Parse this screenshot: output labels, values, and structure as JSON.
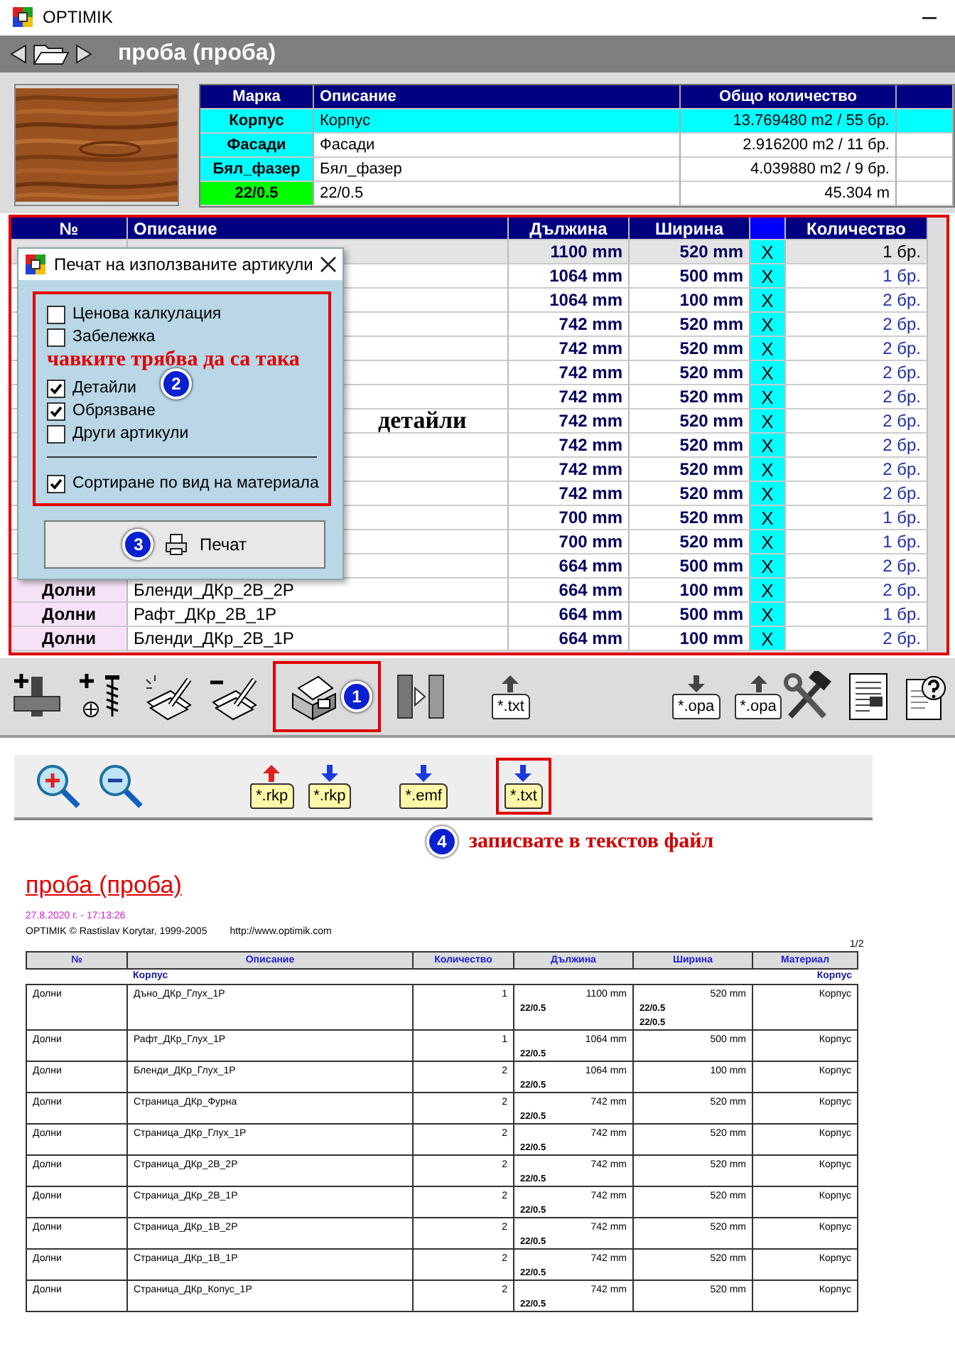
{
  "window": {
    "title": "OPTIMIK"
  },
  "header": {
    "title": "проба  (проба)"
  },
  "materials": {
    "columns": [
      "Марка",
      "Описание",
      "Общо количество"
    ],
    "rows": [
      {
        "mark": "Корпус",
        "description": "Корпус",
        "total": "13.769480 m2 / 55 бр.",
        "color": "#00ffff",
        "selected": true
      },
      {
        "mark": "Фасади",
        "description": "Фасади",
        "total": "2.916200 m2 / 11 бр.",
        "color": "#00ffff",
        "selected": false
      },
      {
        "mark": "Бял_фазер",
        "description": "Бял_фазер",
        "total": "4.039880 m2 / 9 бр.",
        "color": "#00ffff",
        "selected": false
      },
      {
        "mark": "22/0.5",
        "description": "22/0.5",
        "total": "45.304 m",
        "color": "#00ff00",
        "selected": false
      }
    ]
  },
  "parts": {
    "columns": [
      "№",
      "Описание",
      "Дължина",
      "Ширина",
      "Количество"
    ],
    "rows": [
      {
        "length": "1100 mm",
        "width": "520 mm",
        "flag": "X",
        "quantity": "1 бр.",
        "selected": true
      },
      {
        "length": "1064 mm",
        "width": "500 mm",
        "flag": "X",
        "quantity": "1 бр.",
        "selected": false
      },
      {
        "length": "1064 mm",
        "width": "100 mm",
        "flag": "X",
        "quantity": "2 бр.",
        "selected": false
      },
      {
        "length": "742 mm",
        "width": "520 mm",
        "flag": "X",
        "quantity": "2 бр.",
        "selected": false
      },
      {
        "length": "742 mm",
        "width": "520 mm",
        "flag": "X",
        "quantity": "2 бр.",
        "selected": false
      },
      {
        "length": "742 mm",
        "width": "520 mm",
        "flag": "X",
        "quantity": "2 бр.",
        "selected": false
      },
      {
        "length": "742 mm",
        "width": "520 mm",
        "flag": "X",
        "quantity": "2 бр.",
        "selected": false
      },
      {
        "annotation": "детайли",
        "length": "742 mm",
        "width": "520 mm",
        "flag": "X",
        "quantity": "2 бр.",
        "selected": false
      },
      {
        "length": "742 mm",
        "width": "520 mm",
        "flag": "X",
        "quantity": "2 бр.",
        "selected": false
      },
      {
        "length": "742 mm",
        "width": "520 mm",
        "flag": "X",
        "quantity": "2 бр.",
        "selected": false
      },
      {
        "length": "742 mm",
        "width": "520 mm",
        "flag": "X",
        "quantity": "2 бр.",
        "selected": false
      },
      {
        "length": "700 mm",
        "width": "520 mm",
        "flag": "X",
        "quantity": "1 бр.",
        "selected": false
      },
      {
        "length": "700 mm",
        "width": "520 mm",
        "flag": "X",
        "quantity": "1 бр.",
        "selected": false
      },
      {
        "length": "664 mm",
        "width": "500 mm",
        "flag": "X",
        "quantity": "2 бр.",
        "selected": false
      },
      {
        "no": "Долни",
        "description": "Бленди_ДКр_2В_2Р",
        "length": "664 mm",
        "width": "100 mm",
        "flag": "X",
        "quantity": "2 бр.",
        "selected": false
      },
      {
        "no": "Долни",
        "description": "Рафт_ДКр_2В_1Р",
        "length": "664 mm",
        "width": "500 mm",
        "flag": "X",
        "quantity": "1 бр.",
        "selected": false
      },
      {
        "no": "Долни",
        "description": "Бленди_ДКр_2В_1Р",
        "length": "664 mm",
        "width": "100 mm",
        "flag": "X",
        "quantity": "2 бр.",
        "selected": false
      }
    ]
  },
  "dialog": {
    "title": "Печат на използваните артикули",
    "badge": "2",
    "note": "чавките трябва да са така",
    "options": [
      {
        "label": "Ценова калкулация",
        "checked": false
      },
      {
        "label": "Забележка",
        "checked": false
      },
      {
        "label": "Детайли",
        "checked": true
      },
      {
        "label": "Обрязване",
        "checked": true
      },
      {
        "label": "Други артикули",
        "checked": false
      }
    ],
    "sort_option": {
      "label": "Сортиране по вид на материала",
      "checked": true
    },
    "button": {
      "label": "Печат",
      "badge": "3"
    }
  },
  "toolbar": {
    "groups": [
      [
        {
          "kind": "plus-panel"
        },
        {
          "kind": "plus-screw"
        },
        {
          "kind": "pencil-paper"
        },
        {
          "kind": "minus-pencil"
        },
        {
          "kind": "printer",
          "highlighted": true,
          "badge": "1"
        },
        {
          "kind": "split"
        },
        {
          "kind": "file",
          "label": "*.txt",
          "arrow_up": true
        }
      ],
      [
        {
          "kind": "file",
          "label": "*.opa",
          "arrow_up": false
        },
        {
          "kind": "file",
          "label": "*.opa",
          "arrow_up": true
        }
      ],
      [
        {
          "kind": "tools"
        },
        {
          "kind": "document"
        },
        {
          "kind": "help"
        }
      ]
    ]
  },
  "preview": {
    "toolbar": {
      "groups": [
        [
          {
            "kind": "zoom-in"
          },
          {
            "kind": "zoom-out"
          }
        ],
        [
          {
            "kind": "file",
            "label": "*.rkp",
            "arrow_up": true
          },
          {
            "kind": "file",
            "label": "*.rkp",
            "arrow_up": false
          }
        ],
        [
          {
            "kind": "file",
            "label": "*.emf",
            "arrow_up": false
          }
        ],
        [
          {
            "kind": "file",
            "label": "*.txt",
            "arrow_up": false,
            "highlighted": true
          }
        ]
      ]
    },
    "note": {
      "badge": "4",
      "text": "записвате в текстов файл"
    },
    "report": {
      "title": "проба  (проба)",
      "date": "27.8.2020 г.  -  17:13:26",
      "credits": "OPTIMIK  © Rastislav Korytar, 1999-2005",
      "url": "http://www.optimik.com",
      "page": "1/2",
      "columns": [
        "№",
        "Описание",
        "Количество",
        "Дължина",
        "Ширина",
        "Материал"
      ],
      "group": {
        "description": "Корпус",
        "material": "Корпус"
      },
      "rows": [
        {
          "no": "Долни",
          "description": "Дъно_ДКр_Глух_1Р",
          "quantity": "1",
          "length": "1100 mm",
          "length_edges": [
            "22/0.5"
          ],
          "width": "520 mm",
          "width_edges": [
            "22/0.5",
            "22/0.5"
          ],
          "material": "Корпус"
        },
        {
          "no": "Долни",
          "description": "Рафт_ДКр_Глух_1Р",
          "quantity": "1",
          "length": "1064 mm",
          "length_edges": [
            "22/0.5"
          ],
          "width": "500 mm",
          "material": "Корпус"
        },
        {
          "no": "Долни",
          "description": "Бленди_ДКр_Глух_1Р",
          "quantity": "2",
          "length": "1064 mm",
          "length_edges": [
            "22/0.5"
          ],
          "width": "100 mm",
          "material": "Корпус"
        },
        {
          "no": "Долни",
          "description": "Страница_ДКр_Фурна",
          "quantity": "2",
          "length": "742 mm",
          "length_edges": [
            "22/0.5"
          ],
          "width": "520 mm",
          "material": "Корпус"
        },
        {
          "no": "Долни",
          "description": "Страница_ДКр_Глух_1Р",
          "quantity": "2",
          "length": "742 mm",
          "length_edges": [
            "22/0.5"
          ],
          "width": "520 mm",
          "material": "Корпус"
        },
        {
          "no": "Долни",
          "description": "Страница_ДКр_2В_2Р",
          "quantity": "2",
          "length": "742 mm",
          "length_edges": [
            "22/0.5"
          ],
          "width": "520 mm",
          "material": "Корпус"
        },
        {
          "no": "Долни",
          "description": "Страница_ДКр_2В_1Р",
          "quantity": "2",
          "length": "742 mm",
          "length_edges": [
            "22/0.5"
          ],
          "width": "520 mm",
          "material": "Корпус"
        },
        {
          "no": "Долни",
          "description": "Страница_ДКр_1В_2Р",
          "quantity": "2",
          "length": "742 mm",
          "length_edges": [
            "22/0.5"
          ],
          "width": "520 mm",
          "material": "Корпус"
        },
        {
          "no": "Долни",
          "description": "Страница_ДКр_1В_1Р",
          "quantity": "2",
          "length": "742 mm",
          "length_edges": [
            "22/0.5"
          ],
          "width": "520 mm",
          "material": "Корпус"
        },
        {
          "no": "Долни",
          "description": "Страница_ДКр_Копус_1Р",
          "quantity": "2",
          "length": "742 mm",
          "length_edges": [
            "22/0.5"
          ],
          "width": "520 mm",
          "material": "Корпус"
        }
      ]
    }
  }
}
